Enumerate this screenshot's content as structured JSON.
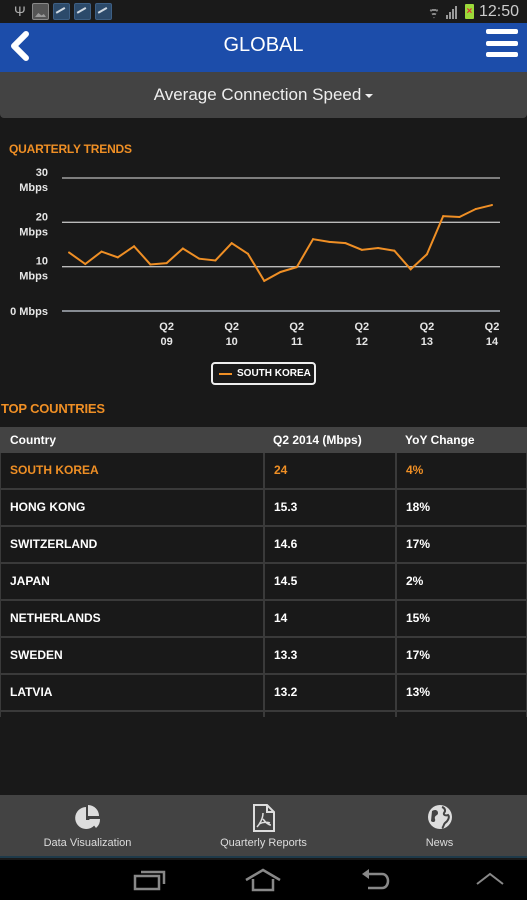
{
  "status_bar": {
    "left_icons": [
      "usb-icon",
      "gallery-icon",
      "app-notification-icon",
      "app-notification-icon",
      "app-notification-icon"
    ],
    "right_icons": [
      "wifi-icon",
      "signal-icon",
      "battery-icon"
    ],
    "time": "12:50"
  },
  "app_bar": {
    "title": "GLOBAL",
    "back_icon": "chevron-left-icon",
    "menu_icon": "hamburger-menu-icon"
  },
  "metric_dropdown": {
    "selected": "Average Connection Speed"
  },
  "trends": {
    "title": "QUARTERLY TRENDS"
  },
  "chart_data": {
    "type": "line",
    "title": "QUARTERLY TRENDS",
    "xlabel": "",
    "ylabel": "",
    "ylim": [
      0,
      30
    ],
    "y_ticks": [
      {
        "value": 30,
        "label": [
          "30",
          "Mbps"
        ]
      },
      {
        "value": 20,
        "label": [
          "20",
          "Mbps"
        ]
      },
      {
        "value": 10,
        "label": [
          "10",
          "Mbps"
        ]
      },
      {
        "value": 0,
        "label": [
          "0 Mbps"
        ]
      }
    ],
    "x_ticks": [
      {
        "index": 6,
        "label": [
          "Q2",
          "09"
        ]
      },
      {
        "index": 10,
        "label": [
          "Q2",
          "10"
        ]
      },
      {
        "index": 14,
        "label": [
          "Q2",
          "11"
        ]
      },
      {
        "index": 18,
        "label": [
          "Q2",
          "12"
        ]
      },
      {
        "index": 22,
        "label": [
          "Q2",
          "13"
        ]
      },
      {
        "index": 26,
        "label": [
          "Q2",
          "14"
        ]
      }
    ],
    "grid": true,
    "legend": "bottom-center",
    "series": [
      {
        "name": "SOUTH KOREA",
        "color": "#ef8f25",
        "values": [
          13.2,
          10.6,
          13.4,
          12.1,
          14.6,
          10.5,
          10.8,
          14.1,
          11.8,
          11.4,
          15.3,
          12.9,
          6.8,
          8.8,
          9.9,
          16.2,
          15.6,
          15.3,
          13.8,
          14.2,
          13.6,
          9.4,
          12.8,
          21.4,
          21.2,
          23.0,
          23.9
        ]
      }
    ]
  },
  "top_countries": {
    "title": "TOP COUNTRIES",
    "columns": [
      "Country",
      "Q2 2014 (Mbps)",
      "YoY Change"
    ],
    "rows": [
      {
        "country": "SOUTH KOREA",
        "speed": "24",
        "yoy": "4%",
        "highlight": true
      },
      {
        "country": "HONG KONG",
        "speed": "15.3",
        "yoy": "18%"
      },
      {
        "country": "SWITZERLAND",
        "speed": "14.6",
        "yoy": "17%"
      },
      {
        "country": "JAPAN",
        "speed": "14.5",
        "yoy": "2%"
      },
      {
        "country": "NETHERLANDS",
        "speed": "14",
        "yoy": "15%"
      },
      {
        "country": "SWEDEN",
        "speed": "13.3",
        "yoy": "17%"
      },
      {
        "country": "LATVIA",
        "speed": "13.2",
        "yoy": "13%"
      }
    ]
  },
  "bottom_nav": {
    "items": [
      {
        "label": "Data Visualization",
        "icon": "pie-chart-icon"
      },
      {
        "label": "Quarterly Reports",
        "icon": "pdf-document-icon"
      },
      {
        "label": "News",
        "icon": "globe-icon"
      }
    ]
  },
  "system_nav": {
    "buttons": [
      "recent-apps-icon",
      "home-icon",
      "back-icon",
      "chevron-up-icon"
    ]
  },
  "colors": {
    "accent": "#ef8f25",
    "app_bar": "#1c4daa",
    "background": "#191919",
    "panel": "#434343"
  }
}
